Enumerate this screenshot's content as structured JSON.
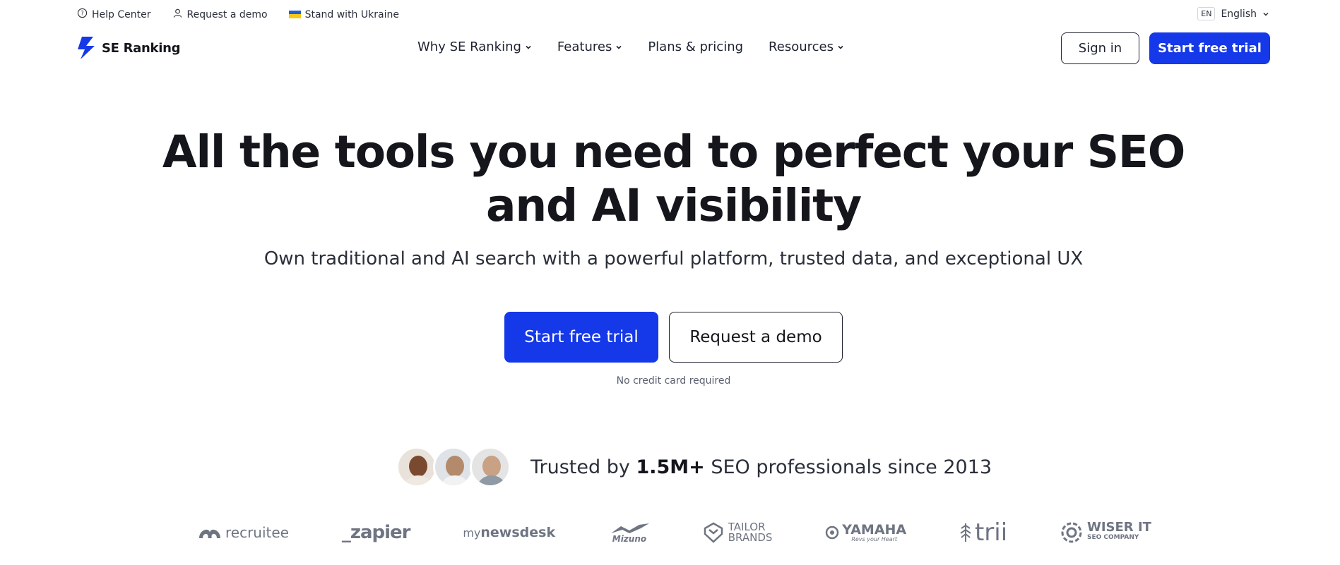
{
  "topbar": {
    "help_center": "Help Center",
    "request_demo": "Request a demo",
    "ukraine": "Stand with Ukraine",
    "lang_code": "EN",
    "lang_label": "English"
  },
  "header": {
    "logo_text": "SE Ranking",
    "nav": [
      {
        "label": "Why SE Ranking",
        "dropdown": true
      },
      {
        "label": "Features",
        "dropdown": true
      },
      {
        "label": "Plans & pricing",
        "dropdown": false
      },
      {
        "label": "Resources",
        "dropdown": true
      }
    ],
    "sign_in": "Sign in",
    "start_trial": "Start free trial"
  },
  "hero": {
    "title_line1": "All the tools you need to perfect your SEO",
    "title_line2": "and AI visibility",
    "subtitle": "Own traditional and AI search with a powerful platform, trusted data, and exceptional UX",
    "cta_primary": "Start free trial",
    "cta_secondary": "Request a demo",
    "note": "No credit card required"
  },
  "trusted": {
    "prefix": "Trusted by",
    "count": "1.5M+",
    "suffix": "SEO professionals since 2013"
  },
  "logos": [
    {
      "name": "recruitee",
      "text": "recruitee"
    },
    {
      "name": "zapier",
      "text": "_zapier"
    },
    {
      "name": "mynewsdesk",
      "text_a": "my",
      "text_b": "newsdesk"
    },
    {
      "name": "mizuno",
      "text": "Mizuno"
    },
    {
      "name": "tailor-brands",
      "line1": "TAILOR",
      "line2": "BRANDS"
    },
    {
      "name": "yamaha",
      "text": "YAMAHA",
      "tag": "Revs your Heart"
    },
    {
      "name": "trii",
      "text": "trii"
    },
    {
      "name": "wiser-it",
      "line1": "WISER IT",
      "line2": "SEO COMPANY"
    }
  ],
  "colors": {
    "accent": "#1538e8",
    "text": "#14161c",
    "muted": "#6e7482"
  }
}
